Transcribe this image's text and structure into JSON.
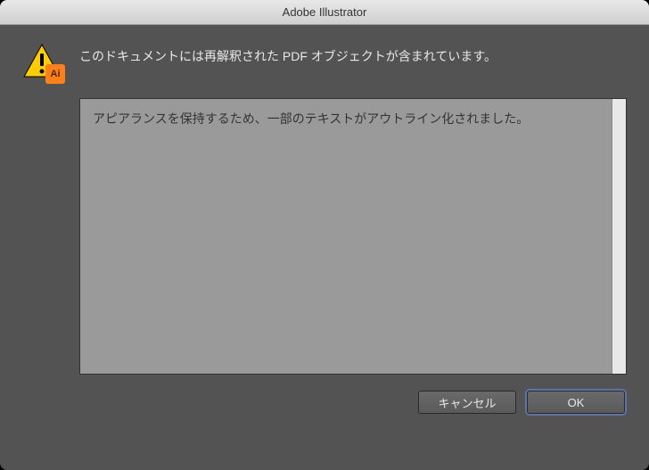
{
  "titlebar": {
    "title": "Adobe Illustrator"
  },
  "icon": {
    "badge_text": "Ai"
  },
  "message": {
    "text": "このドキュメントには再解釈された PDF オブジェクトが含まれています。"
  },
  "detail": {
    "text": "アピアランスを保持するため、一部のテキストがアウトライン化されました。"
  },
  "buttons": {
    "cancel": "キャンセル",
    "ok": "OK"
  }
}
